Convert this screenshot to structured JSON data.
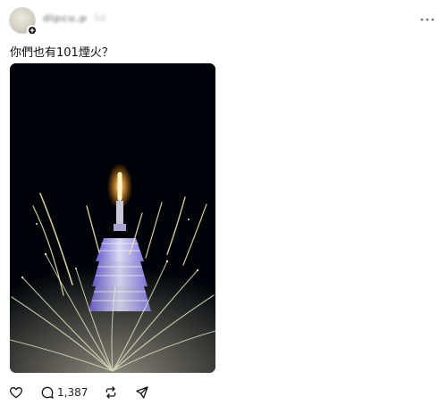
{
  "header": {
    "username": "dipcu.p",
    "timestamp": "3d"
  },
  "post": {
    "text": "你們也有101煙火？",
    "image_icon": "fireworks-photo"
  },
  "actions": {
    "like_icon": "heart-icon",
    "comment_icon": "comment-icon",
    "comment_count": "1,387",
    "repost_icon": "repost-icon",
    "share_icon": "send-icon"
  },
  "colors": {
    "background": "#ffffff",
    "text": "#101010",
    "photo_bg": "#020308"
  }
}
